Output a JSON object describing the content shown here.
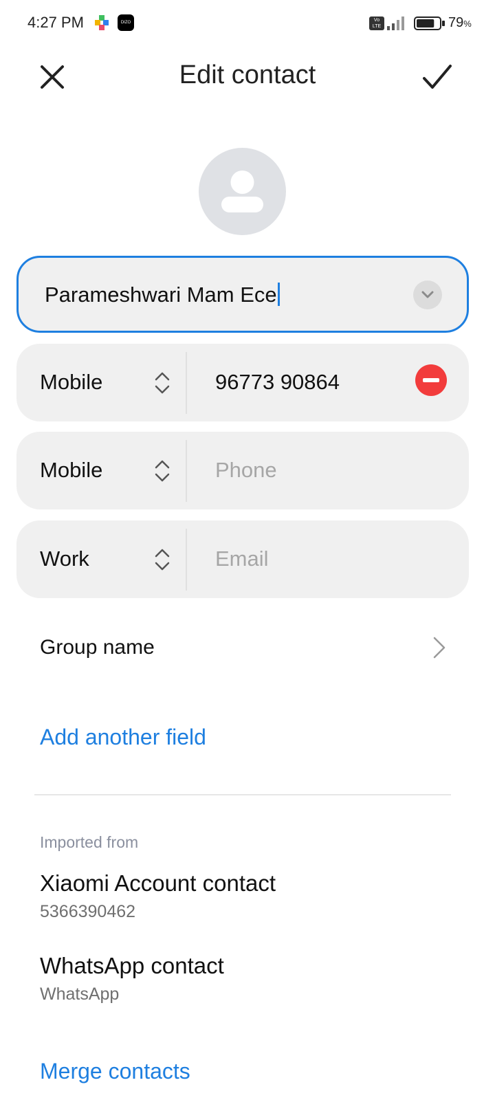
{
  "status_bar": {
    "time": "4:27 PM",
    "app_icon_2_text": "DIZO",
    "volte_text": "Vo LTE",
    "battery_percent": "79",
    "battery_unit": "%",
    "battery_level": 0.79
  },
  "header": {
    "title": "Edit contact",
    "close_icon": "close-icon",
    "save_icon": "checkmark-icon"
  },
  "name_field": {
    "value": "Parameshwari Mam Ece"
  },
  "fields": [
    {
      "type": "Mobile",
      "value": "96773 90864",
      "placeholder": ""
    },
    {
      "type": "Mobile",
      "value": "",
      "placeholder": "Phone"
    },
    {
      "type": "Work",
      "value": "",
      "placeholder": "Email"
    }
  ],
  "group": {
    "label": "Group name"
  },
  "add_field_label": "Add another field",
  "imported": {
    "label": "Imported from",
    "accounts": [
      {
        "title": "Xiaomi Account contact",
        "subtitle": "5366390462"
      },
      {
        "title": "WhatsApp contact",
        "subtitle": "WhatsApp"
      }
    ]
  },
  "merge_label": "Merge contacts",
  "colors": {
    "accent": "#1e7fe0",
    "remove": "#f23c3c",
    "field_bg": "#f0f0f0",
    "avatar_bg": "#dfe1e5"
  }
}
